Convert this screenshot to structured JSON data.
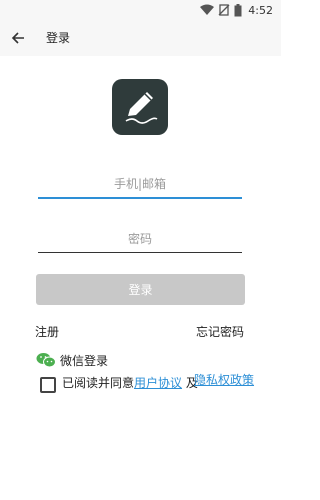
{
  "status": {
    "time": "4:52"
  },
  "toolbar": {
    "title": "登录"
  },
  "form": {
    "phone_placeholder": "手机|邮箱",
    "password_placeholder": "密码",
    "login_label": "登录"
  },
  "links": {
    "register": "注册",
    "forgot_password": "忘记密码"
  },
  "wechat": {
    "label": "微信登录"
  },
  "agreement": {
    "prefix": "已阅读并同意",
    "user_agreement": "用户协议",
    "and": "及",
    "privacy_policy": "隐私权政策"
  },
  "colors": {
    "accent": "#2d8fd6",
    "logo_bg": "#2f3b3b",
    "button_disabled": "#c8c8c8",
    "wechat": "#4caf50"
  }
}
